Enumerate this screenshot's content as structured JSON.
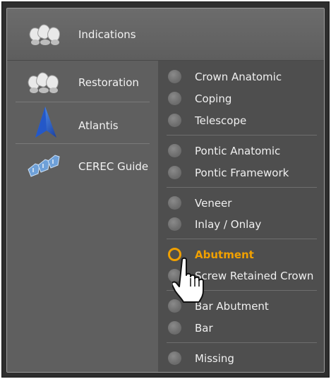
{
  "header": {
    "label": "Indications",
    "icon": "crowns-icon"
  },
  "sidebar": {
    "items": [
      {
        "label": "Restoration",
        "icon": "crowns-icon"
      },
      {
        "label": "Atlantis",
        "icon": "atlantis-logo-icon"
      },
      {
        "label": "CEREC Guide",
        "icon": "cerec-guide-icon"
      }
    ]
  },
  "options": [
    {
      "label": "Crown Anatomic",
      "selected": false
    },
    {
      "label": "Coping",
      "selected": false
    },
    {
      "label": "Telescope",
      "selected": false
    },
    {
      "label": "Pontic Anatomic",
      "selected": false
    },
    {
      "label": "Pontic Framework",
      "selected": false
    },
    {
      "label": "Veneer",
      "selected": false
    },
    {
      "label": "Inlay / Onlay",
      "selected": false
    },
    {
      "label": "Abutment",
      "selected": true
    },
    {
      "label": "Screw Retained Crown",
      "selected": false
    },
    {
      "label": "Bar Abutment",
      "selected": false
    },
    {
      "label": "Bar",
      "selected": false
    },
    {
      "label": "Missing",
      "selected": false
    }
  ],
  "colors": {
    "selected_accent": "#f0a000",
    "text": "#f0f0f0"
  },
  "cursor": {
    "icon": "hand-pointer-icon"
  }
}
